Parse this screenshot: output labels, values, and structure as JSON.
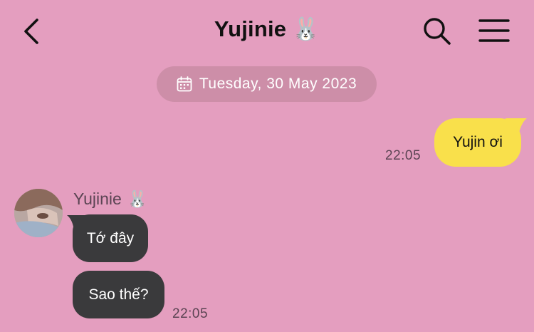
{
  "header": {
    "title": "Yujinie",
    "title_emoji": "🐰",
    "back_icon": "chevron-left-icon",
    "search_icon": "search-icon",
    "menu_icon": "hamburger-menu-icon"
  },
  "date_separator": {
    "icon": "calendar-icon",
    "label": "Tuesday, 30 May 2023"
  },
  "messages": {
    "outgoing": [
      {
        "text": "Yujin ơi",
        "time": "22:05"
      }
    ],
    "incoming": {
      "sender": "Yujinie",
      "sender_emoji": "🐰",
      "items": [
        {
          "text": "Tớ đây"
        },
        {
          "text": "Sao thế?"
        }
      ],
      "time": "22:05"
    }
  },
  "colors": {
    "background": "#e49ebf",
    "outgoing_bubble": "#f9e04b",
    "incoming_bubble": "#3a3a3c",
    "date_pill": "#cd8ea8"
  }
}
